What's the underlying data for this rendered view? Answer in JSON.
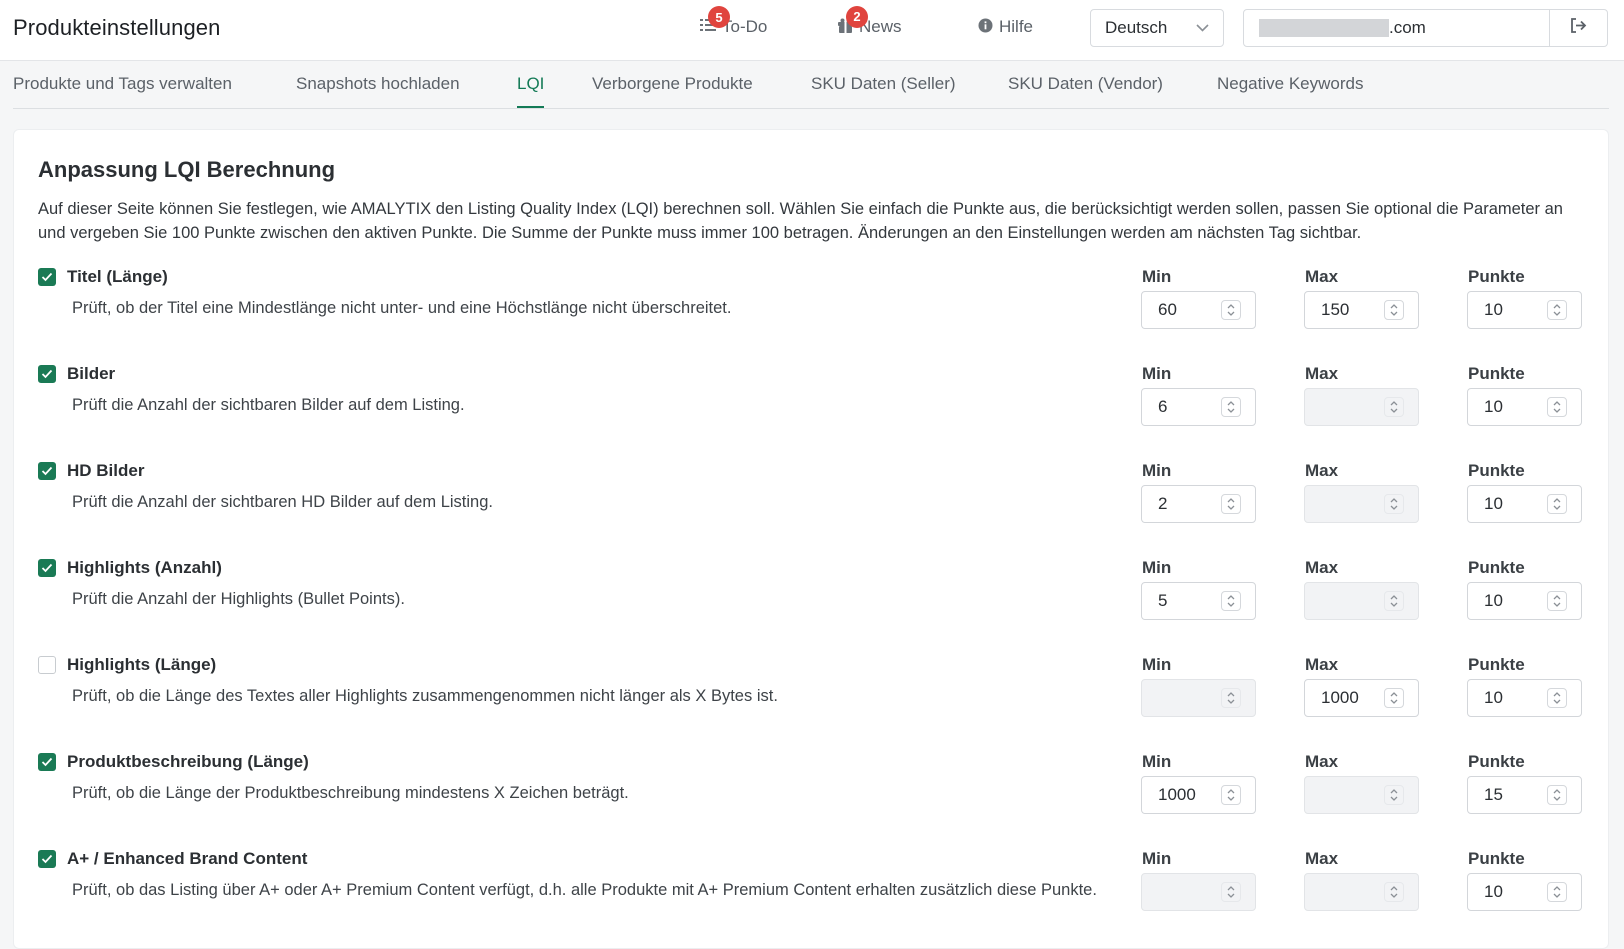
{
  "header": {
    "title": "Produkteinstellungen",
    "todo": {
      "label": "To-Do",
      "count": "5"
    },
    "news": {
      "label": "News",
      "count": "2"
    },
    "help": {
      "label": "Hilfe"
    },
    "language": "Deutsch",
    "account_suffix": ".com",
    "icons": {
      "todo": "list-check-icon",
      "news": "gift-icon",
      "help": "info-icon",
      "logout": "logout-icon",
      "language": "chevron-down-icon"
    },
    "colors": {
      "badge": "#e0443e",
      "accent": "#137a56"
    }
  },
  "tabs": [
    {
      "label": "Produkte und Tags verwalten",
      "active": false
    },
    {
      "label": "Snapshots hochladen",
      "active": false
    },
    {
      "label": "LQI",
      "active": true
    },
    {
      "label": "Verborgene Produkte",
      "active": false
    },
    {
      "label": "SKU Daten (Seller)",
      "active": false
    },
    {
      "label": "SKU Daten (Vendor)",
      "active": false
    },
    {
      "label": "Negative Keywords",
      "active": false
    }
  ],
  "card": {
    "title": "Anpassung LQI Berechnung",
    "description": "Auf dieser Seite können Sie festlegen, wie AMALYTIX den Listing Quality Index (LQI) berechnen soll. Wählen Sie einfach die Punkte aus, die berücksichtigt werden sollen, passen Sie optional die Parameter an und vergeben Sie 100 Punkte zwischen den aktiven Punkte. Die Summe der Punkte muss immer 100 betragen. Änderungen an den Einstellungen werden am nächsten Tag sichtbar."
  },
  "field_labels": {
    "min": "Min",
    "max": "Max",
    "points": "Punkte"
  },
  "criteria": [
    {
      "label": "Titel (Länge)",
      "checked": true,
      "description": "Prüft, ob der Titel eine Mindestlänge nicht unter- und eine Höchstlänge nicht überschreitet.",
      "min": "60",
      "max": "150",
      "points": "10",
      "min_disabled": false,
      "max_disabled": false
    },
    {
      "label": "Bilder",
      "checked": true,
      "description": "Prüft die Anzahl der sichtbaren Bilder auf dem Listing.",
      "min": "6",
      "max": "",
      "points": "10",
      "min_disabled": false,
      "max_disabled": true
    },
    {
      "label": "HD Bilder",
      "checked": true,
      "description": "Prüft die Anzahl der sichtbaren HD Bilder auf dem Listing.",
      "min": "2",
      "max": "",
      "points": "10",
      "min_disabled": false,
      "max_disabled": true
    },
    {
      "label": "Highlights (Anzahl)",
      "checked": true,
      "description": "Prüft die Anzahl der Highlights (Bullet Points).",
      "min": "5",
      "max": "",
      "points": "10",
      "min_disabled": false,
      "max_disabled": true
    },
    {
      "label": "Highlights (Länge)",
      "checked": false,
      "description": "Prüft, ob die Länge des Textes aller Highlights zusammengenommen nicht länger als X Bytes ist.",
      "min": "",
      "max": "1000",
      "points": "10",
      "min_disabled": true,
      "max_disabled": false
    },
    {
      "label": "Produktbeschreibung (Länge)",
      "checked": true,
      "description": "Prüft, ob die Länge der Produktbeschreibung mindestens X Zeichen beträgt.",
      "min": "1000",
      "max": "",
      "points": "15",
      "min_disabled": false,
      "max_disabled": true
    },
    {
      "label": "A+ / Enhanced Brand Content",
      "checked": true,
      "description": "Prüft, ob das Listing über A+ oder A+ Premium Content verfügt, d.h. alle Produkte mit A+ Premium Content erhalten zusätzlich diese Punkte.",
      "min": "",
      "max": "",
      "points": "10",
      "min_disabled": true,
      "max_disabled": true
    }
  ]
}
